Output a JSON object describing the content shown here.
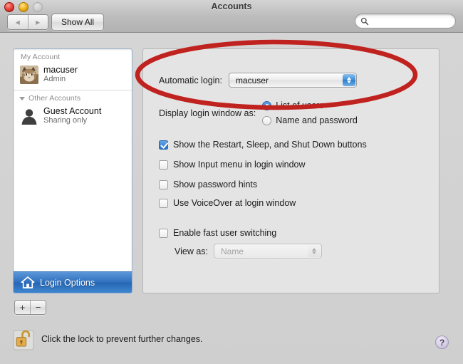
{
  "window": {
    "title": "Accounts",
    "traffic_lights": {
      "close": "close-button",
      "minimize": "minimize-button",
      "zoom": "zoom-button"
    }
  },
  "toolbar": {
    "back_glyph": "◀",
    "forward_glyph": "▶",
    "show_all_label": "Show All",
    "search": {
      "value": "",
      "placeholder": ""
    }
  },
  "sidebar": {
    "groups": [
      {
        "header": "My Account",
        "accounts": [
          {
            "name": "macuser",
            "role": "Admin",
            "avatar": "cat-photo-avatar"
          }
        ]
      },
      {
        "header": "Other Accounts",
        "accounts": [
          {
            "name": "Guest Account",
            "role": "Sharing only",
            "avatar": "person-silhouette-avatar"
          }
        ]
      }
    ],
    "login_options": {
      "label": "Login Options",
      "icon": "house-icon",
      "selected": true
    },
    "add_button": "+",
    "remove_button": "−"
  },
  "main": {
    "automatic_login": {
      "label": "Automatic login:",
      "value": "macuser"
    },
    "display_login_window": {
      "label": "Display login window as:",
      "options": [
        {
          "label": "List of users",
          "selected": true
        },
        {
          "label": "Name and password",
          "selected": false
        }
      ]
    },
    "checkboxes": [
      {
        "label": "Show the Restart, Sleep, and Shut Down buttons",
        "checked": true
      },
      {
        "label": "Show Input menu in login window",
        "checked": false
      },
      {
        "label": "Show password hints",
        "checked": false
      },
      {
        "label": "Use VoiceOver at login window",
        "checked": false
      },
      {
        "label": "Enable fast user switching",
        "checked": false
      }
    ],
    "view_as": {
      "label": "View as:",
      "value": "Name",
      "disabled": true
    }
  },
  "footer": {
    "lock_icon": "open-padlock-icon",
    "lock_text": "Click the lock to prevent further changes.",
    "help_label": "?"
  },
  "annotation": {
    "shape": "red-oval-highlight",
    "color": "#C0231F",
    "target": "automatic-login-row"
  },
  "colors": {
    "selection_blue": "#2F6FBE",
    "annotation_red": "#C0231F",
    "panel_bg": "#E4E4E4",
    "sidebar_bg": "#FFFFFF",
    "lock_gold": "#D9A33E"
  }
}
